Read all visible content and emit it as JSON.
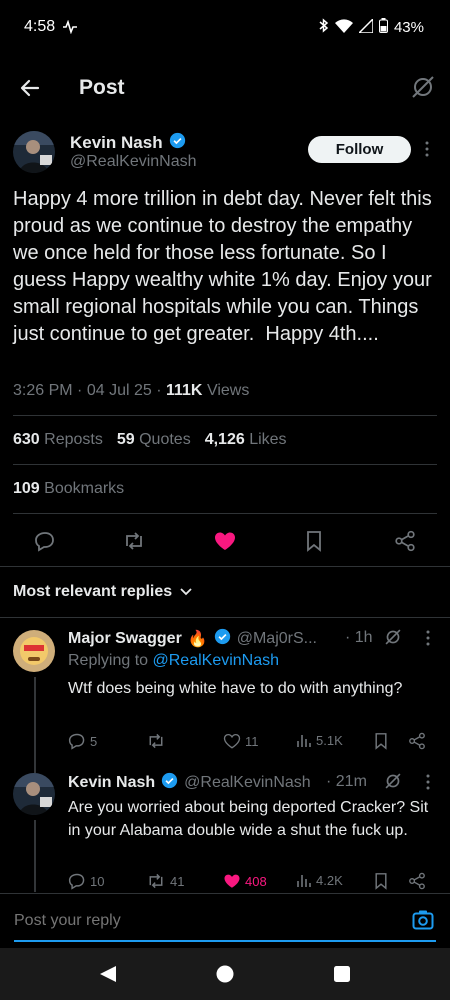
{
  "status": {
    "time": "4:58",
    "battery": "43%"
  },
  "header": {
    "title": "Post"
  },
  "post": {
    "author_name": "Kevin Nash",
    "author_handle": "@RealKevinNash",
    "follow_label": "Follow",
    "text": "Happy 4 more trillion in debt day. Never felt this proud as we continue to destroy the empathy we once held for those less fortunate. So I guess Happy wealthy white 1% day. Enjoy your small regional hospitals while you can. Things just continue to get greater.  Happy 4th....",
    "time": "3:26 PM",
    "date": "04 Jul 25",
    "views_count": "111K",
    "views_label": "Views",
    "reposts_count": "630",
    "reposts_label": "Reposts",
    "quotes_count": "59",
    "quotes_label": "Quotes",
    "likes_count": "4,126",
    "likes_label": "Likes",
    "bookmarks_count": "109",
    "bookmarks_label": "Bookmarks"
  },
  "replies_section": {
    "title": "Most relevant replies"
  },
  "replies": [
    {
      "name": "Major Swagger",
      "emoji": "🔥",
      "handle": "@Maj0rS...",
      "time": "· 1h",
      "replying_prefix": "Replying to",
      "replying_handle": "@RealKevinNash",
      "text": "Wtf does being white have to do with anything?",
      "replies": "5",
      "reposts": "",
      "likes": "11",
      "views": "5.1K"
    },
    {
      "name": "Kevin Nash",
      "handle": "@RealKevinNash",
      "time": "· 21m",
      "text": "Are you worried about being deported Cracker? Sit in your Alabama double wide a shut the fuck up.",
      "replies": "10",
      "reposts": "41",
      "likes": "408",
      "views": "4.2K"
    }
  ],
  "composer": {
    "placeholder": "Post your reply"
  },
  "colors": {
    "accent": "#1d9bf0",
    "like": "#f91880",
    "bg": "#000000",
    "muted": "#71767b"
  }
}
